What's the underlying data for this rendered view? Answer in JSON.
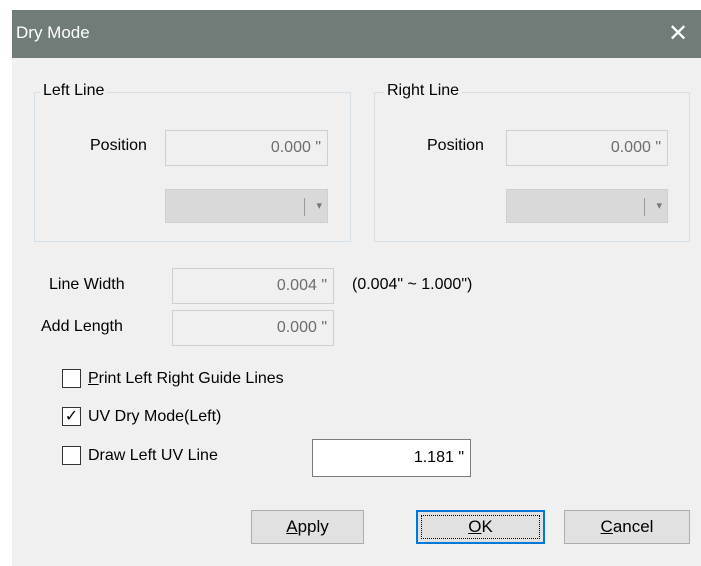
{
  "window": {
    "title": "Dry Mode",
    "close_glyph": "✕"
  },
  "left_group": {
    "legend": "Left Line",
    "position_label": "Position",
    "position_value": "0.000 \"",
    "dropdown_value": ""
  },
  "right_group": {
    "legend": "Right Line",
    "position_label": "Position",
    "position_value": "0.000 \"",
    "dropdown_value": ""
  },
  "line_width": {
    "label": "Line Width",
    "value": "0.004 \"",
    "range": "(0.004\" ~ 1.000\")"
  },
  "add_length": {
    "label": "Add Length",
    "value": "0.000 \""
  },
  "checkboxes": {
    "print_guide": {
      "mnemonic": "P",
      "rest": "rint Left Right Guide Lines",
      "checked": false
    },
    "uv_dry_mode": {
      "label": "UV Dry Mode(Left)",
      "checked": true
    },
    "draw_uv_line": {
      "label": "Draw Left UV Line",
      "checked": false,
      "value": "1.181 \""
    }
  },
  "buttons": {
    "apply": {
      "mnemonic": "A",
      "rest": "pply"
    },
    "ok": {
      "mnemonic": "O",
      "rest": "K"
    },
    "cancel": {
      "mnemonic": "C",
      "rest": "ancel"
    }
  },
  "icons": {
    "check": "✓",
    "dropdown_arrow": "▾"
  }
}
